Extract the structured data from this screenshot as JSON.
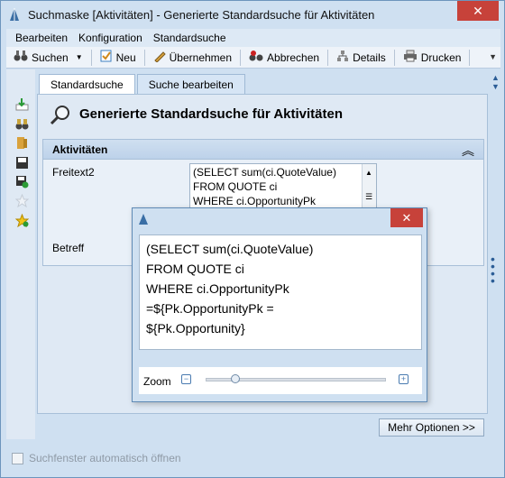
{
  "window": {
    "title": "Suchmaske [Aktivitäten] - Generierte Standardsuche für Aktivitäten",
    "close": "✕"
  },
  "menu": [
    "Bearbeiten",
    "Konfiguration",
    "Standardsuche"
  ],
  "toolbar": {
    "search": "Suchen",
    "new": "Neu",
    "apply": "Übernehmen",
    "cancel": "Abbrechen",
    "details": "Details",
    "print": "Drucken"
  },
  "tabs": [
    "Standardsuche",
    "Suche bearbeiten"
  ],
  "heading": "Generierte Standardsuche für Aktivitäten",
  "group": {
    "title": "Aktivitäten",
    "fields": [
      {
        "label": "Freitext2"
      },
      {
        "label": "Betreff"
      }
    ],
    "freitext_lines": [
      "(SELECT sum(ci.QuoteValue)",
      "FROM QUOTE ci",
      "WHERE ci.OpportunityPk"
    ]
  },
  "more_options": "Mehr Optionen >>",
  "auto_open_label": "Suchfenster automatisch öffnen",
  "popup": {
    "lines": [
      "(SELECT sum(ci.QuoteValue)",
      "FROM QUOTE ci",
      "WHERE ci.OpportunityPk",
      "=${Pk.OpportunityPk =",
      "${Pk.Opportunity}"
    ],
    "zoom_label": "Zoom",
    "zoom_value": 0.16,
    "close": "✕"
  },
  "colors": {
    "accent": "#2b5d96",
    "close": "#c7423a"
  }
}
